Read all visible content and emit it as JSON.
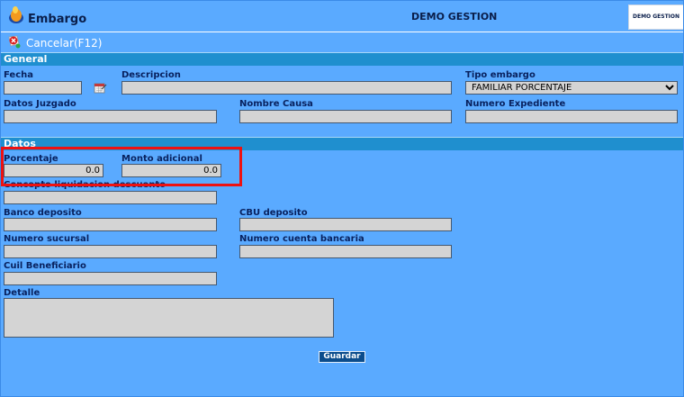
{
  "window": {
    "title": "Embargo",
    "company": "DEMO GESTION",
    "logo_text": "DEMO GESTION"
  },
  "toolbar": {
    "cancel_label": "Cancelar(F12)"
  },
  "sections": {
    "general": "General",
    "datos": "Datos"
  },
  "general": {
    "fecha": {
      "label": "Fecha",
      "value": ""
    },
    "descripcion": {
      "label": "Descripcion",
      "value": ""
    },
    "tipo_embargo": {
      "label": "Tipo embargo",
      "value": "FAMILIAR PORCENTAJE"
    },
    "datos_juzgado": {
      "label": "Datos Juzgado",
      "value": ""
    },
    "nombre_causa": {
      "label": "Nombre Causa",
      "value": ""
    },
    "numero_expediente": {
      "label": "Numero Expediente",
      "value": ""
    }
  },
  "datos": {
    "porcentaje": {
      "label": "Porcentaje",
      "value": "0.0"
    },
    "monto_adicional": {
      "label": "Monto adicional",
      "value": "0.0"
    },
    "concepto": {
      "label": "Concepto liquidacion descuento",
      "value": ""
    },
    "banco_deposito": {
      "label": "Banco deposito",
      "value": ""
    },
    "cbu_deposito": {
      "label": "CBU deposito",
      "value": ""
    },
    "numero_sucursal": {
      "label": "Numero sucursal",
      "value": ""
    },
    "numero_cuenta": {
      "label": "Numero cuenta bancaria",
      "value": ""
    },
    "cuil_beneficiario": {
      "label": "Cuil Beneficiario",
      "value": ""
    },
    "detalle": {
      "label": "Detalle",
      "value": ""
    }
  },
  "actions": {
    "save_label": "Guardar"
  },
  "icons": {
    "app": "coins-icon",
    "cancel": "cancel-icon",
    "calendar": "calendar-icon"
  },
  "colors": {
    "background": "#5aaaff",
    "section_bar": "#1f8fcf",
    "label_text": "#08215e",
    "highlight": "#ee1111",
    "button": "#0b4c8c"
  }
}
